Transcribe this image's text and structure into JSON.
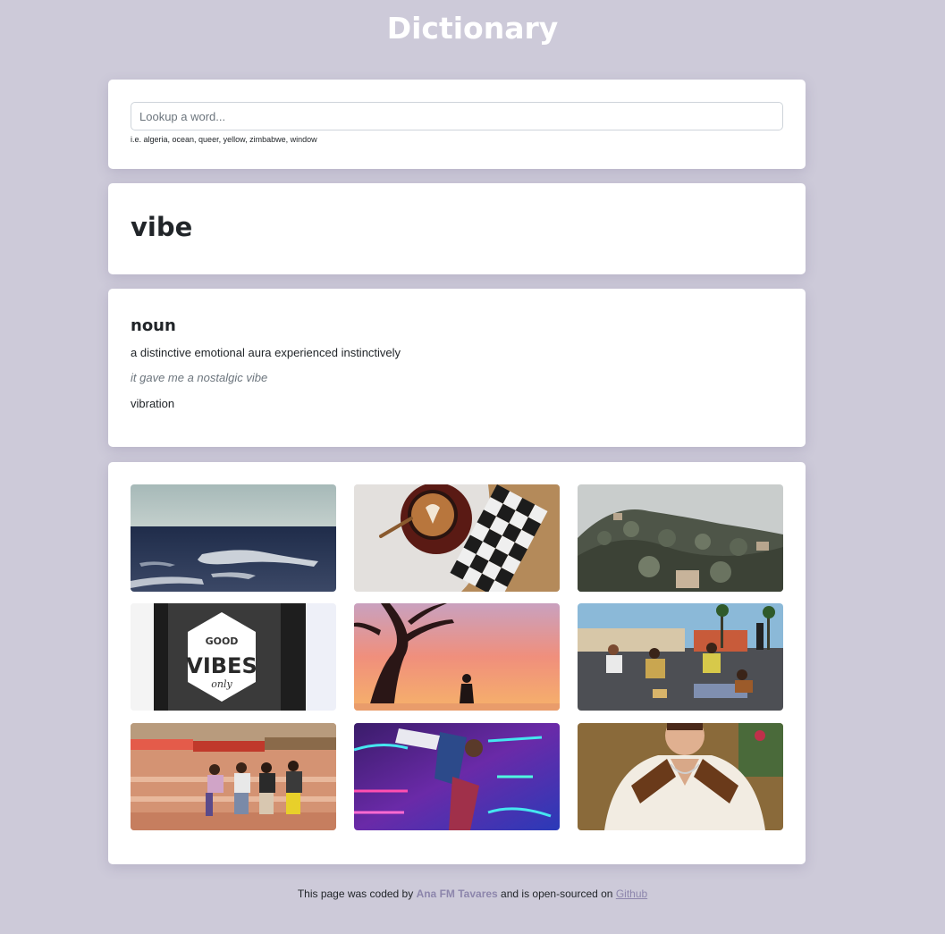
{
  "app": {
    "title": "Dictionary"
  },
  "search": {
    "placeholder": "Lookup a word...",
    "value": "",
    "hint": "i.e. algeria, ocean, queer, yellow, zimbabwe, window"
  },
  "result": {
    "word": "vibe",
    "meanings": [
      {
        "part_of_speech": "noun",
        "definition": "a distinctive emotional aura experienced instinctively",
        "example": "it gave me a nostalgic vibe",
        "synonyms": "vibration"
      }
    ]
  },
  "photos": [
    {
      "icon": "ocean-waves-photo"
    },
    {
      "icon": "latte-coffee-photo"
    },
    {
      "icon": "hillside-town-photo"
    },
    {
      "icon": "good-vibes-sign-photo"
    },
    {
      "icon": "sunset-tree-photo"
    },
    {
      "icon": "roller-skaters-photo"
    },
    {
      "icon": "skaters-sitting-photo"
    },
    {
      "icon": "neon-dancer-photo"
    },
    {
      "icon": "man-patterned-shirt-photo"
    }
  ],
  "photo_text": {
    "good": "GOOD",
    "vibes": "VIBES",
    "only": "only"
  },
  "footer": {
    "prefix": "This page was coded by ",
    "author": "Ana FM Tavares",
    "middle": " and is open-sourced on ",
    "link": "Github"
  },
  "colors": {
    "background": "#cdcad9",
    "accent": "#8d86ac",
    "card": "#ffffff"
  }
}
